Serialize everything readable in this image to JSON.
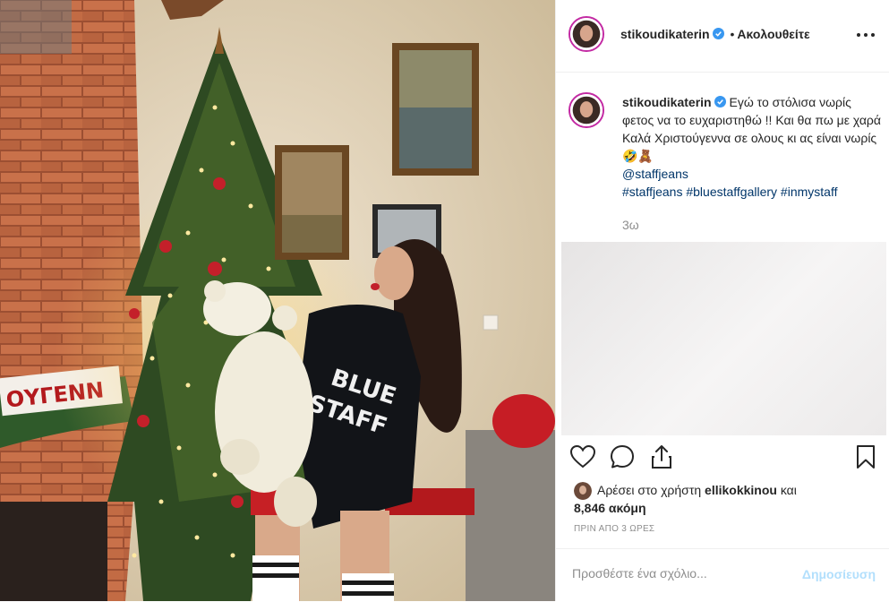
{
  "header": {
    "username": "stikoudikaterin",
    "separator": "•",
    "follow_status": "Ακολουθείτε",
    "more_icon": "more-horizontal-icon"
  },
  "photo": {
    "sign_text": "ΟΥΓΕΝΝ",
    "sweater_line1": "BLUE",
    "sweater_line2": "STAFF"
  },
  "caption": {
    "username": "stikoudikaterin",
    "text": "Εγώ το στόλισα νωρίς φετος να το ευχαριστηθώ !! Και θα πω με χαρά Καλά Χριστούγεννα σε ολους κι ας είναι νωρίς 🤣🧸",
    "mention": "@staffjeans",
    "hashtags": "#staffjeans #bluestaffgallery #inmystaff",
    "time": "3ω"
  },
  "actions": {
    "like_icon": "heart-icon",
    "comment_icon": "comment-icon",
    "share_icon": "share-icon",
    "save_icon": "bookmark-icon"
  },
  "likes": {
    "prefix": "Αρέσει στο χρήστη",
    "user": "ellikokkinou",
    "conj": "και",
    "count": "8,846 ακόμη"
  },
  "timestamp": "ΠΡΙΝ ΑΠΟ 3 ΩΡΕΣ",
  "comment_box": {
    "placeholder": "Προσθέστε ένα σχόλιο...",
    "post_label": "Δημοσίευση"
  },
  "colors": {
    "verified": "#3897f0",
    "link": "#003569",
    "post_disabled": "#b2dffc",
    "muted": "#8e8e8e"
  }
}
